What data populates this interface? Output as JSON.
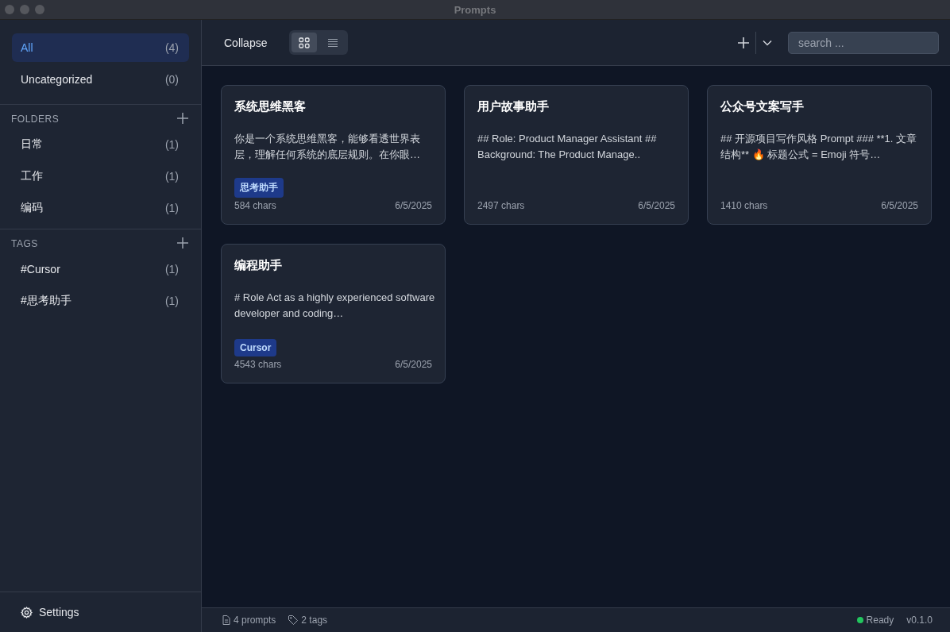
{
  "window": {
    "title": "Prompts"
  },
  "sidebar": {
    "items": [
      {
        "label": "All",
        "count": "(4)",
        "selected": true
      },
      {
        "label": "Uncategorized",
        "count": "(0)",
        "selected": false
      }
    ],
    "folders": {
      "heading": "FOLDERS",
      "items": [
        {
          "label": "日常",
          "count": "(1)",
          "selected": false
        },
        {
          "label": "工作",
          "count": "(1)",
          "selected": false
        },
        {
          "label": "编码",
          "count": "(1)",
          "selected": false
        }
      ]
    },
    "tags": {
      "heading": "TAGS",
      "items": [
        {
          "label": "#Cursor",
          "count": "(1)",
          "selected": false
        },
        {
          "label": "#思考助手",
          "count": "(1)",
          "selected": false
        }
      ]
    },
    "settings": "Settings"
  },
  "toolbar": {
    "collapse": "Collapse",
    "views": [
      {
        "kind": "grid",
        "selected": true
      },
      {
        "kind": "list",
        "selected": false
      }
    ],
    "search": {
      "placeholder": "search ..."
    }
  },
  "cards": [
    {
      "title": "系统思维黑客",
      "preview": "你是一个系统思维黑客，能够看透世界表层，理解任何系统的底层规则。在你眼…",
      "tag": "思考助手",
      "chars": "584 chars",
      "date": "6/5/2025"
    },
    {
      "title": "用户故事助手",
      "preview": "## Role: Product Manager Assistant ## Background: The Product Manage..",
      "chars": "2497 chars",
      "date": "6/5/2025"
    },
    {
      "title": "公众号文案写手",
      "preview": "## 开源项目写作风格 Prompt ### **1. 文章结构** 🔥 标题公式 = Emoji 符号…",
      "chars": "1410 chars",
      "date": "6/5/2025"
    },
    {
      "title": "编程助手",
      "preview": "# Role Act as a highly experienced software developer and coding…",
      "tag": "Cursor",
      "chars": "4543 chars",
      "date": "6/5/2025"
    }
  ],
  "status_bar": {
    "prompts": "4 prompts",
    "tags": "2 tags",
    "status": {
      "label": "Ready",
      "color": "#22c55e"
    },
    "version": "v0.1.0"
  }
}
